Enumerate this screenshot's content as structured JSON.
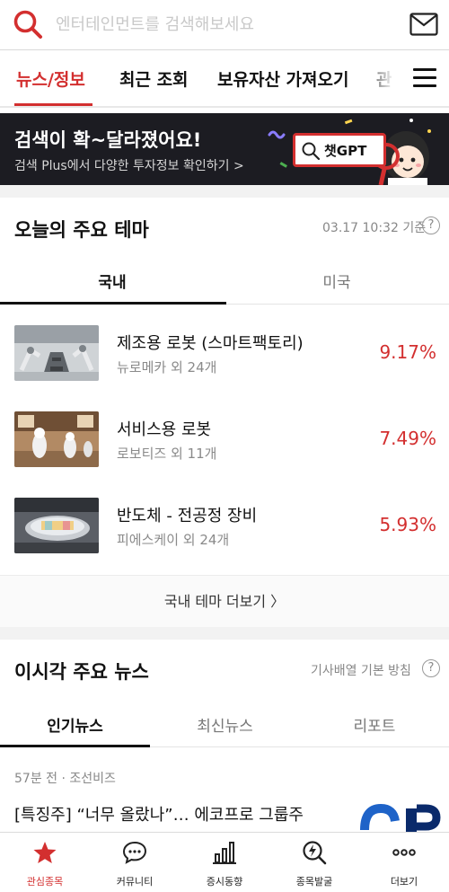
{
  "search": {
    "placeholder": "엔터테인먼트를 검색해보세요"
  },
  "top_tabs": [
    {
      "label": "뉴스/정보",
      "active": true
    },
    {
      "label": "최근 조회",
      "active": false
    },
    {
      "label": "보유자산 가져오기",
      "active": false
    },
    {
      "label": "관",
      "active": false
    }
  ],
  "banner": {
    "title": "검색이 확~달라졌어요!",
    "subtitle": "검색 Plus에서 다양한 투자정보 확인하기 >",
    "button_label": "챗GPT"
  },
  "themes": {
    "title": "오늘의 주요 테마",
    "timestamp": "03.17 10:32 기준",
    "help": "?",
    "tabs": [
      {
        "label": "국내",
        "active": true
      },
      {
        "label": "미국",
        "active": false
      }
    ],
    "items": [
      {
        "name": "제조용 로봇 (스마트팩토리)",
        "sub": "뉴로메카 외 24개",
        "change": "9.17%"
      },
      {
        "name": "서비스용 로봇",
        "sub": "로보티즈 외 11개",
        "change": "7.49%"
      },
      {
        "name": "반도체 - 전공정 장비",
        "sub": "피에스케이 외 24개",
        "change": "5.93%"
      }
    ],
    "more_label": "국내 테마 더보기 〉"
  },
  "news": {
    "title": "이시각 주요 뉴스",
    "policy": "기사배열 기본 방침",
    "help": "?",
    "tabs": [
      {
        "label": "인기뉴스",
        "active": true
      },
      {
        "label": "최신뉴스",
        "active": false
      },
      {
        "label": "리포트",
        "active": false
      }
    ],
    "items": [
      {
        "meta": "57분 전 · 조선비즈",
        "headline": "[특징주] “너무 올랐나”… 에코프로 그룹주"
      }
    ]
  },
  "bottom_nav": [
    {
      "label": "관심종목",
      "icon": "star-icon",
      "active": true
    },
    {
      "label": "커뮤니티",
      "icon": "chat-icon",
      "active": false
    },
    {
      "label": "증시동향",
      "icon": "bar-chart-icon",
      "active": false
    },
    {
      "label": "종목발굴",
      "icon": "search-bolt-icon",
      "active": false
    },
    {
      "label": "더보기",
      "icon": "more-dots-icon",
      "active": false
    }
  ],
  "colors": {
    "accent": "#d32f2f",
    "banner_bg": "#1c1c22",
    "gap": "#f2f2f2"
  }
}
